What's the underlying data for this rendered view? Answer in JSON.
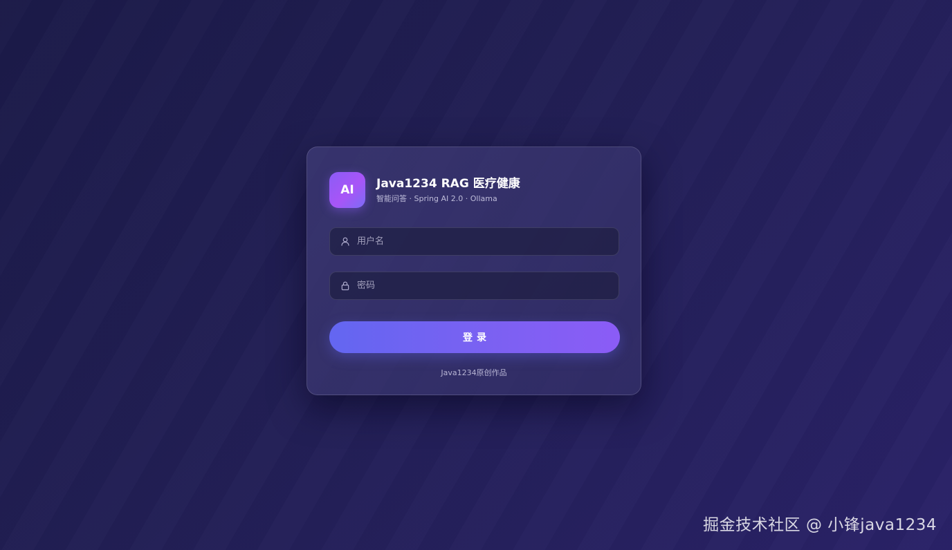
{
  "brand": {
    "logo_text": "AI",
    "title": "Java1234 RAG 医疗健康",
    "subtitle": "智能问答 · Spring AI 2.0 · Ollama"
  },
  "form": {
    "username": {
      "placeholder": "用户名",
      "value": "",
      "icon": "user-icon"
    },
    "password": {
      "placeholder": "密码",
      "value": "",
      "icon": "lock-icon"
    },
    "submit_label": "登录"
  },
  "footer": {
    "credit": "Java1234原创作品"
  },
  "watermark": {
    "text": "掘金技术社区 @ 小锋java1234"
  },
  "colors": {
    "background": "#1f1d52",
    "card": "#3a3670",
    "accent_start": "#6366f1",
    "accent_end": "#8b5cf6",
    "logo": "#a855f7"
  }
}
